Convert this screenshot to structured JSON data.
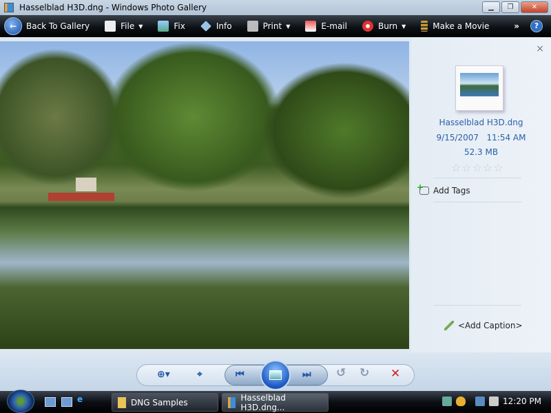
{
  "window": {
    "title": "Hasselblad H3D.dng - Windows Photo Gallery"
  },
  "toolbar": {
    "back": "Back To Gallery",
    "file": "File",
    "fix": "Fix",
    "info": "Info",
    "print": "Print",
    "email": "E-mail",
    "burn": "Burn",
    "movie": "Make a Movie",
    "more": "»",
    "help": "?"
  },
  "info_pane": {
    "close": "×",
    "filename": "Hasselblad H3D.dng",
    "date": "9/15/2007",
    "time": "11:54 AM",
    "size": "52.3 MB",
    "rating": 0,
    "stars": "☆☆☆☆☆",
    "add_tags": "Add Tags",
    "add_caption": "<Add Caption>"
  },
  "controls": {
    "zoom": "⊕▾",
    "fit": "⌖",
    "prev": "⏮",
    "next": "⏭",
    "rotate_ccw": "↺",
    "rotate_cw": "↻",
    "delete": "✕"
  },
  "taskbar": {
    "tasks": [
      "DNG Samples",
      "Hasselblad H3D.dng..."
    ],
    "clock": "12:20 PM"
  },
  "colors": {
    "accent": "#2a5fa6",
    "delete": "#d02020"
  }
}
